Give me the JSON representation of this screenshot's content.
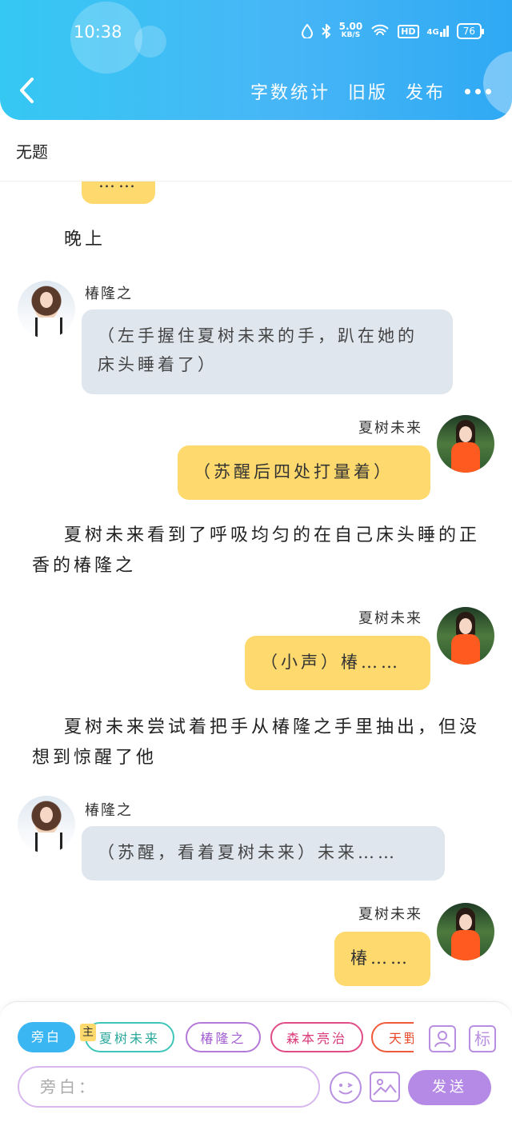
{
  "status_bar": {
    "time": "10:38",
    "net_speed_value": "5.00",
    "net_speed_unit": "KB/S",
    "hd_label": "HD",
    "signal_label": "4G",
    "battery": "76"
  },
  "toolbar": {
    "word_count": "字数统计",
    "old_version": "旧版",
    "publish": "发布"
  },
  "doc_title": "无题",
  "chat": {
    "top_partial_bubble": "……",
    "narration_1": "晚上",
    "msg_1": {
      "speaker": "椿隆之",
      "text": "（左手握住夏树未来的手，趴在她的床头睡着了）"
    },
    "msg_2": {
      "speaker": "夏树未来",
      "text": "（苏醒后四处打量着）"
    },
    "narration_2": "夏树未来看到了呼吸均匀的在自己床头睡的正香的椿隆之",
    "msg_3": {
      "speaker": "夏树未来",
      "text": "（小声）椿……"
    },
    "narration_3": "夏树未来尝试着把手从椿隆之手里抽出，但没想到惊醒了他",
    "msg_4": {
      "speaker": "椿隆之",
      "text": "（苏醒，看着夏树未来）未来……"
    },
    "msg_5": {
      "speaker": "夏树未来",
      "text": "椿……"
    }
  },
  "composer": {
    "roles": [
      "旁白",
      "夏树未来",
      "椿隆之",
      "森本亮治",
      "天野"
    ],
    "main_tag": "主",
    "tag_icon_label": "标",
    "input_placeholder": "旁白：",
    "send_label": "发送"
  },
  "colors": {
    "header_blue": "#47b6f6",
    "bubble_gray": "#e0e6ee",
    "bubble_yellow": "#fdd96e",
    "send_purple": "#b58ae6"
  }
}
